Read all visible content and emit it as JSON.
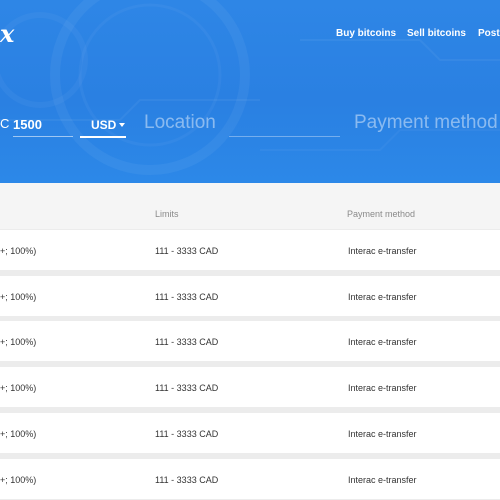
{
  "header": {
    "logo_text": "x",
    "nav": [
      "Buy bitcoins",
      "Sell bitcoins",
      "Post A"
    ]
  },
  "search": {
    "amount_prefix": "C",
    "amount_value": "1500",
    "currency": "USD",
    "location_placeholder": "Location",
    "payment_placeholder": "Payment method"
  },
  "table": {
    "headers": {
      "limits": "Limits",
      "payment_method": "Payment method"
    },
    "rows": [
      {
        "price": "+; 100%)",
        "limits": "111 - 3333 CAD",
        "payment": "Interac e-transfer"
      },
      {
        "price": "+; 100%)",
        "limits": "111 - 3333 CAD",
        "payment": "Interac e-transfer"
      },
      {
        "price": "+; 100%)",
        "limits": "111 - 3333 CAD",
        "payment": "Interac e-transfer"
      },
      {
        "price": "+; 100%)",
        "limits": "111 - 3333 CAD",
        "payment": "Interac e-transfer"
      },
      {
        "price": "+; 100%)",
        "limits": "111 - 3333 CAD",
        "payment": "Interac e-transfer"
      },
      {
        "price": "+; 100%)",
        "limits": "111 - 3333 CAD",
        "payment": "Interac e-transfer"
      }
    ]
  },
  "colors": {
    "hero_blue": "#2a80e2",
    "row_bg": "#ffffff",
    "gap_bg": "#ececec"
  }
}
